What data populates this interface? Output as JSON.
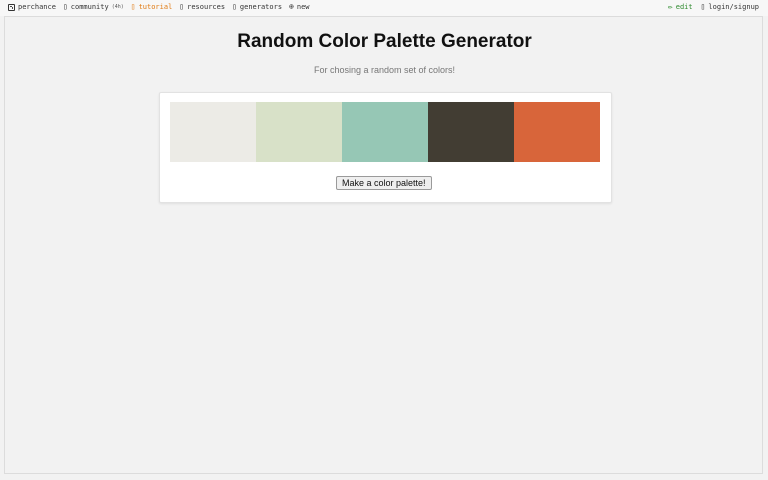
{
  "nav": {
    "brand": "perchance",
    "community": "community",
    "community_tag": "(4h)",
    "tutorial": "tutorial",
    "resources": "resources",
    "generators": "generators",
    "new": "new",
    "edit": "edit",
    "login": "login/signup",
    "icons": {
      "brand": "dice-icon",
      "community": "chat-icon",
      "tutorial": "book-icon",
      "resources": "folder-icon",
      "generators": "list-icon",
      "new": "plus-circle-icon",
      "edit": "pencil-icon",
      "login": "user-icon"
    }
  },
  "main": {
    "title": "Random Color Palette Generator",
    "subtitle": "For chosing a random set of colors!",
    "button_label": "Make a color palette!",
    "palette": [
      "#ecebe6",
      "#d8e1c8",
      "#96c7b5",
      "#423d33",
      "#d8653a"
    ]
  },
  "colors": {
    "tutorial_link": "#e07b14",
    "edit_link": "#2d8a2d"
  }
}
